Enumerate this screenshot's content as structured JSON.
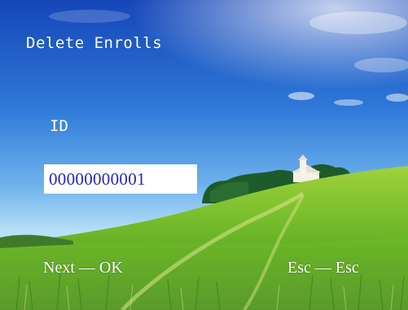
{
  "screen": {
    "title": "Delete Enrolls"
  },
  "form": {
    "id_label": "ID",
    "id_value": "00000000001"
  },
  "footer": {
    "next_hint": "Next — OK",
    "esc_hint": "Esc — Esc"
  },
  "background": {
    "description_icon": "landscape-wallpaper",
    "sky_top": "#1a4fc2",
    "sky_mid": "#3d8fe2",
    "sky_low": "#9fd3f5",
    "grass_light": "#a8d63a",
    "grass_dark": "#3f8a1c",
    "tree_color": "#1f5a2a",
    "chapel_color": "#f4f1e6"
  }
}
